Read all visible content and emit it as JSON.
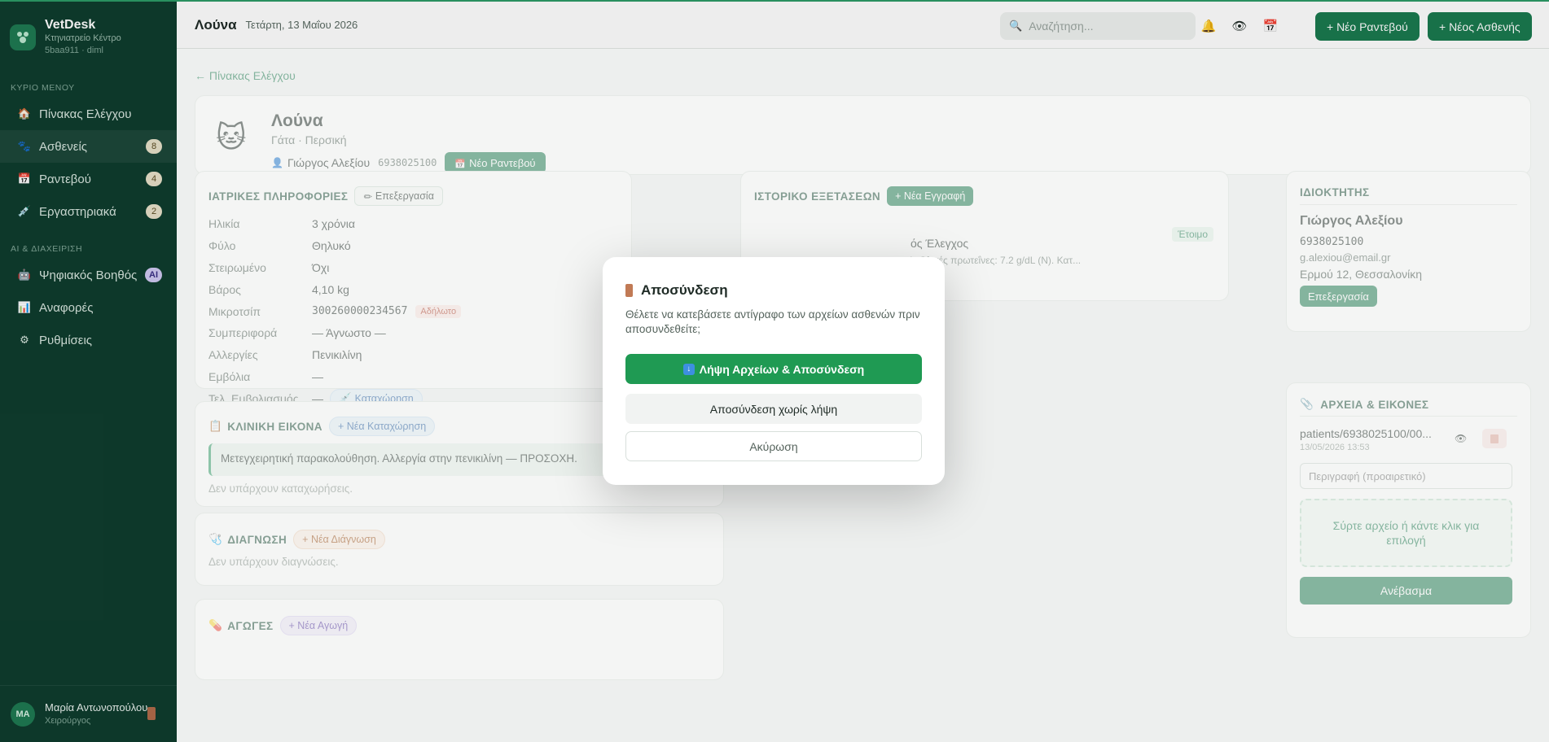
{
  "app": {
    "name": "VetDesk",
    "subtitle": "Κτηνιατρείο Κέντρο",
    "build": "5baa911 · diml"
  },
  "sidebar": {
    "section_main": "ΚΥΡΙΟ ΜΕΝΟΥ",
    "section_ai": "AI & ΔΙΑΧΕΙΡΙΣΗ",
    "items": [
      {
        "label": "Πίνακας Ελέγχου",
        "icon": "house-icon"
      },
      {
        "label": "Ασθενείς",
        "icon": "paw-icon",
        "badge": "8"
      },
      {
        "label": "Ραντεβού",
        "icon": "calendar-icon",
        "badge": "4"
      },
      {
        "label": "Εργαστηριακά",
        "icon": "syringe-icon",
        "badge": "2"
      },
      {
        "label": "Ψηφιακός Βοηθός",
        "icon": "robot-icon",
        "badge": "AI"
      },
      {
        "label": "Αναφορές",
        "icon": "chart-icon"
      },
      {
        "label": "Ρυθμίσεις",
        "icon": "gear-icon"
      }
    ],
    "user": {
      "initials": "MA",
      "name": "Μαρία Αντωνοπούλου",
      "role": "Χειρούργος"
    }
  },
  "topbar": {
    "title": "Λούνα",
    "date": "Τετάρτη, 13 Μαΐου 2026",
    "search_placeholder": "Αναζήτηση...",
    "new_appointment": "+ Νέο Ραντεβού",
    "new_patient": "+ Νέος Ασθενής"
  },
  "main": {
    "back": "← Πίνακας Ελέγχου",
    "patient": {
      "name": "Λούνα",
      "species": "Γάτα · Περσική",
      "owner": "Γιώργος Αλεξίου",
      "phone": "6938025100",
      "new_appt": "Νέο Ραντεβού"
    },
    "medical": {
      "title": "ΙΑΤΡΙΚΕΣ ΠΛΗΡΟΦΟΡΙΕΣ",
      "edit": "Επεξεργασία",
      "rows": [
        {
          "k": "Ηλικία",
          "v": "3 χρόνια"
        },
        {
          "k": "Φύλο",
          "v": "Θηλυκό"
        },
        {
          "k": "Στειρωμένο",
          "v": "Όχι"
        },
        {
          "k": "Βάρος",
          "v": "4,10 kg"
        },
        {
          "k": "Μικροτσίπ",
          "v": "300260000234567"
        },
        {
          "k": "Συμπεριφορά",
          "v": "— Άγνωστο —"
        },
        {
          "k": "Αλλεργίες",
          "v": "Πενικιλίνη"
        },
        {
          "k": "Εμβόλια",
          "v": "—"
        },
        {
          "k": "Τελ. Εμβολιασμός",
          "v": "—"
        }
      ],
      "chip_undeclared": "Αδήλωτο",
      "register": "Καταχώρηση"
    },
    "clinical": {
      "title": "ΚΛΙΝΙΚΗ ΕΙΚΟΝΑ",
      "add": "+ Νέα Καταχώρηση",
      "note": "Μετεγχειρητική παρακολούθηση. Αλλεργία στην πενικιλίνη — ΠΡΟΣΟΧΗ.",
      "empty": "Δεν υπάρχουν καταχωρήσεις."
    },
    "diagnosis": {
      "title": "ΔΙΑΓΝΩΣΗ",
      "add": "+ Νέα Διάγνωση",
      "empty": "Δεν υπάρχουν διαγνώσεις."
    },
    "treatments": {
      "title": "ΑΓΩΓΕΣ",
      "add": "+ Νέα Αγωγή"
    },
    "exams": {
      "title": "ΙΣΤΟΡΙΚΟ ΕΞΕΤΑΣΕΩΝ",
      "add": "+ Νέα Εγγραφή",
      "status": "Έτοιμο",
      "item_title": "ός Έλεγχος",
      "item_sub": "). Ολικές πρωτεΐνες: 7.2 g/dL (N). Κατ..."
    },
    "owner": {
      "title": "ΙΔΙΟΚΤΗΤΗΣ",
      "name": "Γιώργος Αλεξίου",
      "phone": "6938025100",
      "email": "g.alexiou@email.gr",
      "address": "Ερμού 12, Θεσσαλονίκη",
      "edit": "Επεξεργασία"
    },
    "files": {
      "title": "ΑΡΧΕΙΑ & ΕΙΚΟΝΕΣ",
      "file_name": "patients/6938025100/00...",
      "file_date": "13/05/2026 13:53",
      "desc_placeholder": "Περιγραφή (προαιρετικό)",
      "drop_text": "Σύρτε αρχείο ή κάντε κλικ για επιλογή",
      "upload": "Ανέβασμα"
    }
  },
  "modal": {
    "title": "Αποσύνδεση",
    "text": "Θέλετε να κατεβάσετε αντίγραφο των αρχείων ασθενών πριν αποσυνδεθείτε;",
    "btn_download": "Λήψη Αρχείων & Αποσύνδεση",
    "btn_no_download": "Αποσύνδεση χωρίς λήψη",
    "btn_cancel": "Ακύρωση"
  }
}
